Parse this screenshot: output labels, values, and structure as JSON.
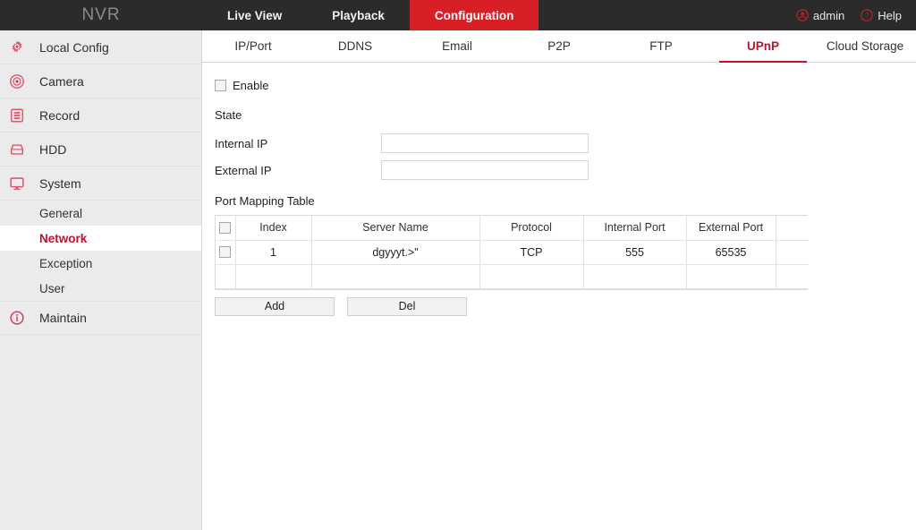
{
  "header": {
    "brand": "NVR",
    "nav": [
      {
        "label": "Live View",
        "active": false
      },
      {
        "label": "Playback",
        "active": false
      },
      {
        "label": "Configuration",
        "active": true
      }
    ],
    "user": {
      "icon": "user-icon",
      "label": "admin"
    },
    "help": {
      "icon": "help-icon",
      "label": "Help"
    },
    "accent": "#d81f26"
  },
  "sidebar": {
    "items": [
      {
        "label": "Local Config",
        "icon": "gear-icon"
      },
      {
        "label": "Camera",
        "icon": "camera-icon"
      },
      {
        "label": "Record",
        "icon": "record-icon"
      },
      {
        "label": "HDD",
        "icon": "hdd-icon"
      },
      {
        "label": "System",
        "icon": "monitor-icon"
      }
    ],
    "sub_items": [
      {
        "label": "General",
        "active": false
      },
      {
        "label": "Network",
        "active": true
      },
      {
        "label": "Exception",
        "active": false
      },
      {
        "label": "User",
        "active": false
      }
    ],
    "maintain": {
      "label": "Maintain",
      "icon": "info-icon"
    },
    "active_color": "#c1122c"
  },
  "subtabs": [
    {
      "label": "IP/Port",
      "active": false
    },
    {
      "label": "DDNS",
      "active": false
    },
    {
      "label": "Email",
      "active": false
    },
    {
      "label": "P2P",
      "active": false
    },
    {
      "label": "FTP",
      "active": false
    },
    {
      "label": "UPnP",
      "active": true
    },
    {
      "label": "Cloud Storage",
      "active": false
    }
  ],
  "form": {
    "enable_label": "Enable",
    "enable_checked": false,
    "state_label": "State",
    "state_value": "",
    "internal_ip_label": "Internal IP",
    "internal_ip_value": "",
    "internal_ip_placeholder": "",
    "external_ip_label": "External IP",
    "external_ip_value": "",
    "external_ip_placeholder": "",
    "table_title": "Port Mapping Table"
  },
  "table": {
    "columns": [
      "",
      "Index",
      "Server Name",
      "Protocol",
      "Internal Port",
      "External Port",
      ""
    ],
    "rows": [
      {
        "checked": false,
        "index": "1",
        "server_name": "dgyyyt.>\"",
        "protocol": "TCP",
        "internal_port": "555",
        "external_port": "65535",
        "end": ""
      }
    ]
  },
  "buttons": {
    "add_label": "Add",
    "del_label": "Del"
  }
}
